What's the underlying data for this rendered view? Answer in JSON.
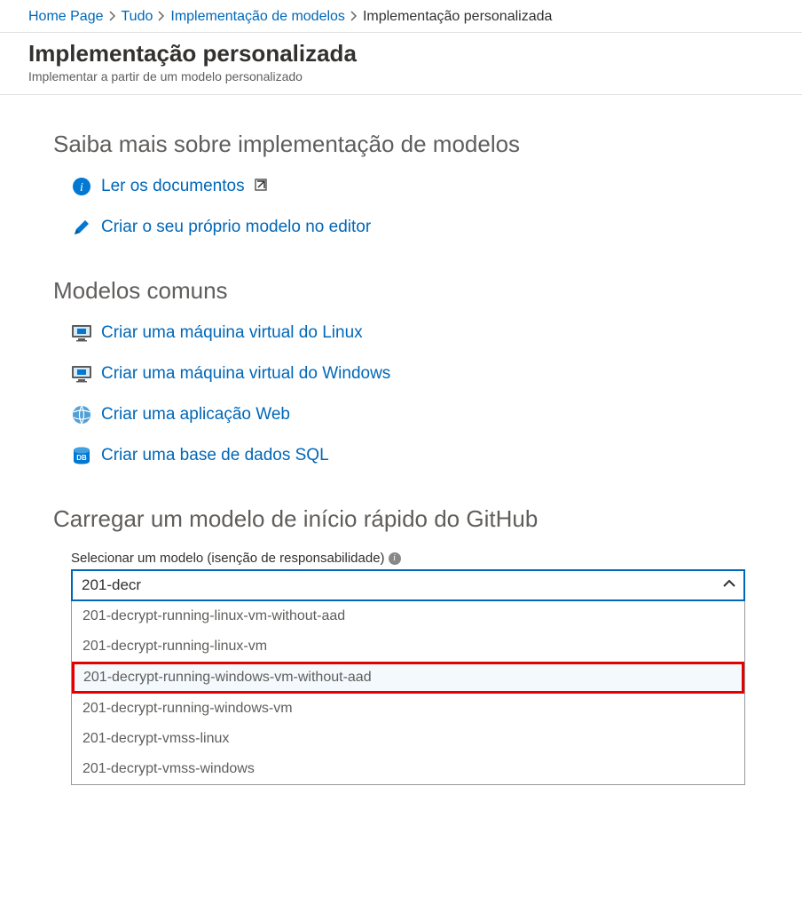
{
  "breadcrumb": {
    "items": [
      {
        "label": "Home Page"
      },
      {
        "label": "Tudo"
      },
      {
        "label": "Implementação de modelos"
      }
    ],
    "current": "Implementação personalizada"
  },
  "header": {
    "title": "Implementação personalizada",
    "subtitle": "Implementar a partir de um modelo personalizado"
  },
  "sections": {
    "learn": {
      "title": "Saiba mais sobre implementação de modelos",
      "links": {
        "docs": "Ler os documentos",
        "editor": "Criar o seu próprio modelo no editor"
      }
    },
    "common": {
      "title": "Modelos comuns",
      "links": {
        "linuxvm": "Criar uma máquina virtual do Linux",
        "winvm": "Criar uma máquina virtual do Windows",
        "webapp": "Criar uma aplicação Web",
        "sqldb": "Criar uma base de dados SQL"
      }
    },
    "github": {
      "title": "Carregar um modelo de início rápido do GitHub",
      "field_label": "Selecionar um modelo (isenção de responsabilidade)",
      "input_value": "201-decr",
      "options": [
        "201-decrypt-running-linux-vm-without-aad",
        "201-decrypt-running-linux-vm",
        "201-decrypt-running-windows-vm-without-aad",
        "201-decrypt-running-windows-vm",
        "201-decrypt-vmss-linux",
        "201-decrypt-vmss-windows"
      ],
      "highlighted_index": 2
    }
  },
  "colors": {
    "link": "#0067b8",
    "highlight_border": "#e50000"
  }
}
